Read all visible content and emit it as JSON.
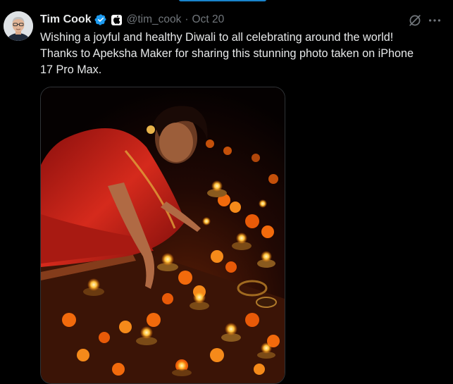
{
  "tweet": {
    "author": {
      "display_name": "Tim Cook",
      "handle": "@tim_cook",
      "avatar_icon": "profile-photo"
    },
    "separator": "·",
    "timestamp": "Oct 20",
    "text_lines": [
      "Wishing a joyful and healthy Diwali to all celebrating around the world!",
      "Thanks to Apeksha Maker for sharing this stunning photo taken on iPhone",
      "17 Pro Max."
    ],
    "badges": {
      "verified_icon": "verified-check-icon",
      "affiliate_icon": "apple-logo-icon"
    },
    "actions": {
      "grok_icon": "grok-icon",
      "more_icon": "more-options-icon"
    },
    "media": {
      "kind": "photo",
      "description_icon": "diwali-photo"
    }
  },
  "colors": {
    "background": "#000000",
    "text_primary": "#e7e9ea",
    "text_secondary": "#71767b",
    "verified_blue": "#1d9bf0",
    "sari_red": "#c0241a",
    "marigold": "#f26a0c"
  }
}
